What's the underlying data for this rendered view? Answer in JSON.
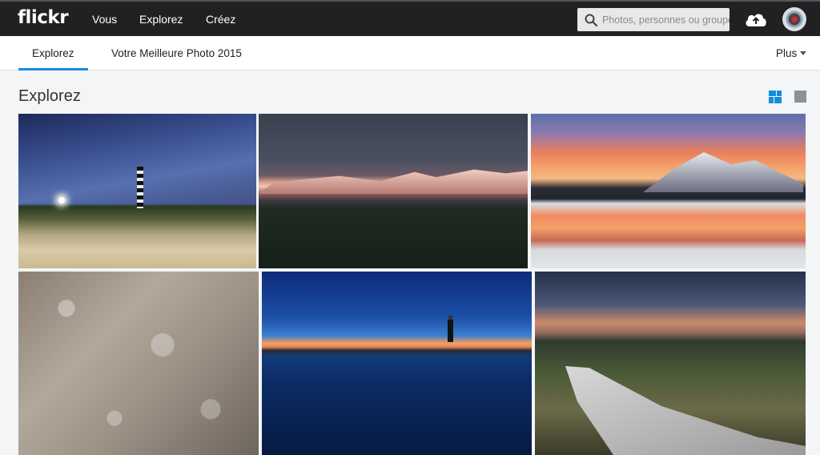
{
  "topbar": {
    "logo": "flickr",
    "nav": [
      {
        "label": "Vous"
      },
      {
        "label": "Explorez"
      },
      {
        "label": "Créez"
      }
    ],
    "search_placeholder": "Photos, personnes ou groupes",
    "upload_icon": "cloud-upload-icon",
    "avatar_icon": "user-avatar"
  },
  "subbar": {
    "tabs": [
      {
        "label": "Explorez",
        "active": true
      },
      {
        "label": "Votre Meilleure Photo 2015",
        "active": false
      }
    ],
    "more_label": "Plus",
    "accent_color": "#128fdc"
  },
  "main": {
    "title": "Explorez",
    "view_icons": [
      "justified-view-icon",
      "single-view-icon"
    ],
    "photos": [
      {
        "subject": "lighthouse-dunes-night-photo"
      },
      {
        "subject": "mountain-sunset-photo"
      },
      {
        "subject": "lake-mountain-sunset-photo"
      },
      {
        "subject": "bokeh-plants-photo"
      },
      {
        "subject": "blue-hour-lighthouse-photo"
      },
      {
        "subject": "canyon-sunset-photo"
      }
    ]
  }
}
